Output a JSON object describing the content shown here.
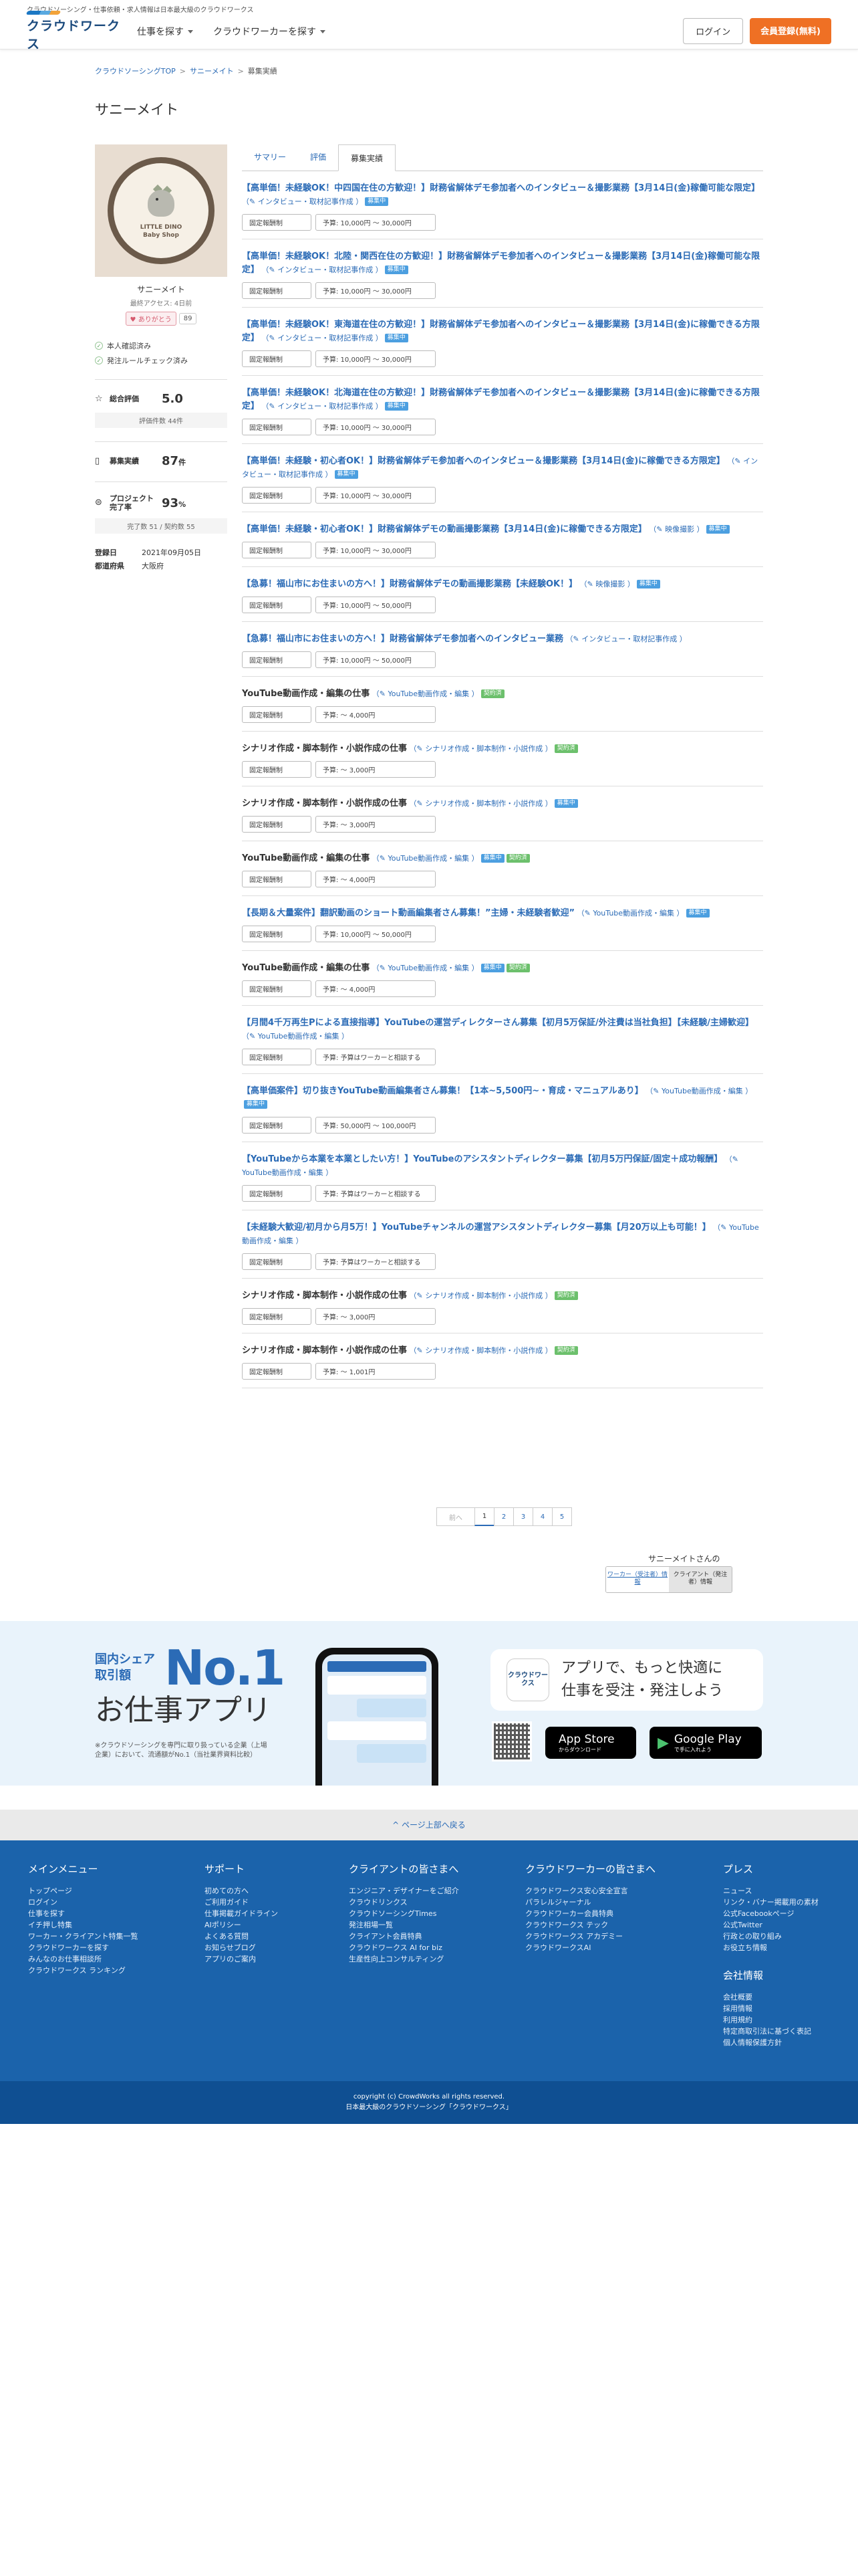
{
  "topstrip": "クラウドソーシング・仕事依頼・求人情報は日本最大級のクラウドワークス",
  "header": {
    "logo": "クラウドワークス",
    "nav": [
      "仕事を探す",
      "クラウドワーカーを探す"
    ],
    "login": "ログイン",
    "signup": "会員登録(無料)"
  },
  "breadcrumb": [
    "クラウドソーシングTOP",
    "サニーメイト",
    "募集実績"
  ],
  "page_title": "サニーメイト",
  "profile": {
    "shop_line1": "LITTLE DINO",
    "shop_line2": "Baby Shop",
    "name": "サニーメイト",
    "last_access": "最終アクセス: 4日前",
    "thanks": "ありがとう",
    "thanks_count": "89",
    "checks": [
      "本人確認済み",
      "発注ルールチェック済み"
    ],
    "rating_label": "総合評価",
    "rating": "5.0",
    "rating_count": "評価件数 44件",
    "recruit_label": "募集実績",
    "recruit_count": "87",
    "recruit_unit": "件",
    "completion_label": "プロジェクト完了率",
    "completion": "93",
    "completion_unit": "%",
    "completion_sub": "完了数 51 / 契約数 55",
    "registered_label": "登録日",
    "registered": "2021年09月05日",
    "pref_label": "都道府県",
    "pref": "大阪府"
  },
  "tabs": [
    "サマリー",
    "評価",
    "募集実績"
  ],
  "jobs": [
    {
      "title": "【高単価！未経験OK！中四国在住の方歓迎！】財務省解体デモ参加者へのインタビュー＆撮影業務【3月14日(金)稼働可能な限定】",
      "cat": "インタビュー・取材記事作成",
      "badges": [
        "募集中"
      ],
      "fee": "固定報酬制",
      "budget": "予算: 10,000円 〜 30,000円",
      "style": "blue"
    },
    {
      "title": "【高単価！未経験OK！北陸・関西在住の方歓迎！】財務省解体デモ参加者へのインタビュー＆撮影業務【3月14日(金)稼働可能な限定】",
      "cat": "インタビュー・取材記事作成",
      "badges": [
        "募集中"
      ],
      "fee": "固定報酬制",
      "budget": "予算: 10,000円 〜 30,000円",
      "style": "blue"
    },
    {
      "title": "【高単価！未経験OK！東海道在住の方歓迎！】財務省解体デモ参加者へのインタビュー＆撮影業務【3月14日(金)に稼働できる方限定】",
      "cat": "インタビュー・取材記事作成",
      "badges": [
        "募集中"
      ],
      "fee": "固定報酬制",
      "budget": "予算: 10,000円 〜 30,000円",
      "style": "blue"
    },
    {
      "title": "【高単価！未経験OK！北海道在住の方歓迎！】財務省解体デモ参加者へのインタビュー＆撮影業務【3月14日(金)に稼働できる方限定】",
      "cat": "インタビュー・取材記事作成",
      "badges": [
        "募集中"
      ],
      "fee": "固定報酬制",
      "budget": "予算: 10,000円 〜 30,000円",
      "style": "blue"
    },
    {
      "title": "【高単価！未経験・初心者OK！】財務省解体デモ参加者へのインタビュー＆撮影業務【3月14日(金)に稼働できる方限定】",
      "cat": "インタビュー・取材記事作成",
      "badges": [
        "募集中"
      ],
      "fee": "固定報酬制",
      "budget": "予算: 10,000円 〜 30,000円",
      "style": "blue"
    },
    {
      "title": "【高単価！未経験・初心者OK！】財務省解体デモの動画撮影業務【3月14日(金)に稼働できる方限定】",
      "cat": "映像撮影",
      "badges": [
        "募集中"
      ],
      "fee": "固定報酬制",
      "budget": "予算: 10,000円 〜 30,000円",
      "style": "blue"
    },
    {
      "title": "【急募！福山市にお住まいの方へ！】財務省解体デモの動画撮影業務【未経験OK！】",
      "cat": "映像撮影",
      "badges": [
        "募集中"
      ],
      "fee": "固定報酬制",
      "budget": "予算: 10,000円 〜 50,000円",
      "style": "blue"
    },
    {
      "title": "【急募！福山市にお住まいの方へ！】財務省解体デモ参加者へのインタビュー業務",
      "cat": "インタビュー・取材記事作成",
      "badges": [],
      "fee": "固定報酬制",
      "budget": "予算: 10,000円 〜 50,000円",
      "style": "blue"
    },
    {
      "title": "YouTube動画作成・編集の仕事",
      "cat": "YouTube動画作成・編集",
      "badges": [
        "契約済"
      ],
      "fee": "固定報酬制",
      "budget": "予算: 〜 4,000円",
      "style": "dark"
    },
    {
      "title": "シナリオ作成・脚本制作・小説作成の仕事",
      "cat": "シナリオ作成・脚本制作・小説作成",
      "badges": [
        "契約済"
      ],
      "fee": "固定報酬制",
      "budget": "予算: 〜 3,000円",
      "style": "dark"
    },
    {
      "title": "シナリオ作成・脚本制作・小説作成の仕事",
      "cat": "シナリオ作成・脚本制作・小説作成",
      "badges": [
        "募集中"
      ],
      "fee": "固定報酬制",
      "budget": "予算: 〜 3,000円",
      "style": "dark"
    },
    {
      "title": "YouTube動画作成・編集の仕事",
      "cat": "YouTube動画作成・編集",
      "badges": [
        "募集中",
        "契約済"
      ],
      "fee": "固定報酬制",
      "budget": "予算: 〜 4,000円",
      "style": "dark"
    },
    {
      "title": "【長期＆大量案件】翻訳動画のショート動画編集者さん募集！”主婦・未経験者歓迎”",
      "cat": "YouTube動画作成・編集",
      "badges": [
        "募集中"
      ],
      "fee": "固定報酬制",
      "budget": "予算: 10,000円 〜 50,000円",
      "style": "blue"
    },
    {
      "title": "YouTube動画作成・編集の仕事",
      "cat": "YouTube動画作成・編集",
      "badges": [
        "募集中",
        "契約済"
      ],
      "fee": "固定報酬制",
      "budget": "予算: 〜 4,000円",
      "style": "dark"
    },
    {
      "title": "【月間4千万再生Pによる直接指導】YouTubeの運営ディレクターさん募集【初月5万保証/外注費は当社負担】【未経験/主婦歓迎】",
      "cat": "YouTube動画作成・編集",
      "badges": [],
      "fee": "固定報酬制",
      "budget": "予算: 予算はワーカーと相談する",
      "style": "blue"
    },
    {
      "title": "【高単価案件】切り抜きYouTube動画編集者さん募集！【1本~5,500円~・育成・マニュアルあり】",
      "cat": "YouTube動画作成・編集",
      "badges": [
        "募集中"
      ],
      "fee": "固定報酬制",
      "budget": "予算: 50,000円 〜 100,000円",
      "style": "blue"
    },
    {
      "title": "【YouTubeから本業を本業としたい方！】YouTubeのアシスタントディレクター募集【初月5万円保証/固定＋成功報酬】",
      "cat": "YouTube動画作成・編集",
      "badges": [],
      "fee": "固定報酬制",
      "budget": "予算: 予算はワーカーと相談する",
      "style": "blue"
    },
    {
      "title": "【未経験大歓迎/初月から月5万！】YouTubeチャンネルの運営アシスタントディレクター募集【月20万以上も可能！】",
      "cat": "YouTube動画作成・編集",
      "badges": [],
      "fee": "固定報酬制",
      "budget": "予算: 予算はワーカーと相談する",
      "style": "blue"
    },
    {
      "title": "シナリオ作成・脚本制作・小説作成の仕事",
      "cat": "シナリオ作成・脚本制作・小説作成",
      "badges": [
        "契約済"
      ],
      "fee": "固定報酬制",
      "budget": "予算: 〜 3,000円",
      "style": "dark"
    },
    {
      "title": "シナリオ作成・脚本制作・小説作成の仕事",
      "cat": "シナリオ作成・脚本制作・小説作成",
      "badges": [
        "契約済"
      ],
      "fee": "固定報酬制",
      "budget": "予算: 〜 1,001円",
      "style": "dark"
    }
  ],
  "pager": {
    "prev": "前へ",
    "pages": [
      "1",
      "2",
      "3",
      "4",
      "5"
    ]
  },
  "switch": {
    "label": "サニーメイトさんの",
    "worker": "ワーカー（受注者）情報",
    "client": "クライアント（発注者）情報"
  },
  "app": {
    "line1": "国内シェア",
    "line2": "取引額",
    "no1": "No.1",
    "big": "お仕事アプリ",
    "note": "※クラウドソーシングを専門に取り扱っている企業（上場企業）において、流通額がNo.1（当社業界資料比較）",
    "icon": "クラウドワークス",
    "bubble1": "アプリで、もっと快適に",
    "bubble2": "仕事を受注・発注しよう",
    "appstore_small": "",
    "appstore": "App Store",
    "appstore_sub": "からダウンロード",
    "gplay": "Google Play",
    "gplay_sub": "で手に入れよう"
  },
  "pagetop": "ページ上部へ戻る",
  "footer": {
    "cols": [
      {
        "title": "メインメニュー",
        "items": [
          "トップページ",
          "ログイン",
          "仕事を探す",
          "イチ押し特集",
          "ワーカー・クライアント特集一覧",
          "クラウドワーカーを探す",
          "みんなのお仕事相談所",
          "クラウドワークス ランキング"
        ]
      },
      {
        "title": "サポート",
        "items": [
          "初めての方へ",
          "ご利用ガイド",
          "仕事掲載ガイドライン",
          "AIポリシー",
          "よくある質問",
          "お知らせブログ",
          "アプリのご案内"
        ]
      },
      {
        "title": "クライアントの皆さまへ",
        "items": [
          "エンジニア・デザイナーをご紹介",
          "クラウドリンクス",
          "クラウドソーシングTimes",
          "発注相場一覧",
          "クライアント会員特典",
          "クラウドワークス AI for biz",
          "生産性向上コンサルティング"
        ]
      },
      {
        "title": "クラウドワーカーの皆さまへ",
        "items": [
          "クラウドワークス安心安全宣言",
          "パラレルジャーナル",
          "クラウドワーカー会員特典",
          "クラウドワークス テック",
          "クラウドワークス アカデミー",
          "クラウドワークスAI"
        ]
      },
      {
        "title": "プレス",
        "items": [
          "ニュース",
          "リンク・バナー掲載用の素材",
          "公式Facebookページ",
          "公式Twitter",
          "行政との取り組み",
          "お役立ち情報"
        ]
      }
    ],
    "company_title": "会社情報",
    "company": [
      "会社概要",
      "採用情報",
      "利用規約",
      "特定商取引法に基づく表記",
      "個人情報保護方針"
    ],
    "copyright": "copyright (c) CrowdWorks all rights reserved.",
    "tagline": "日本最大級のクラウドソーシング「クラウドワークス」"
  }
}
